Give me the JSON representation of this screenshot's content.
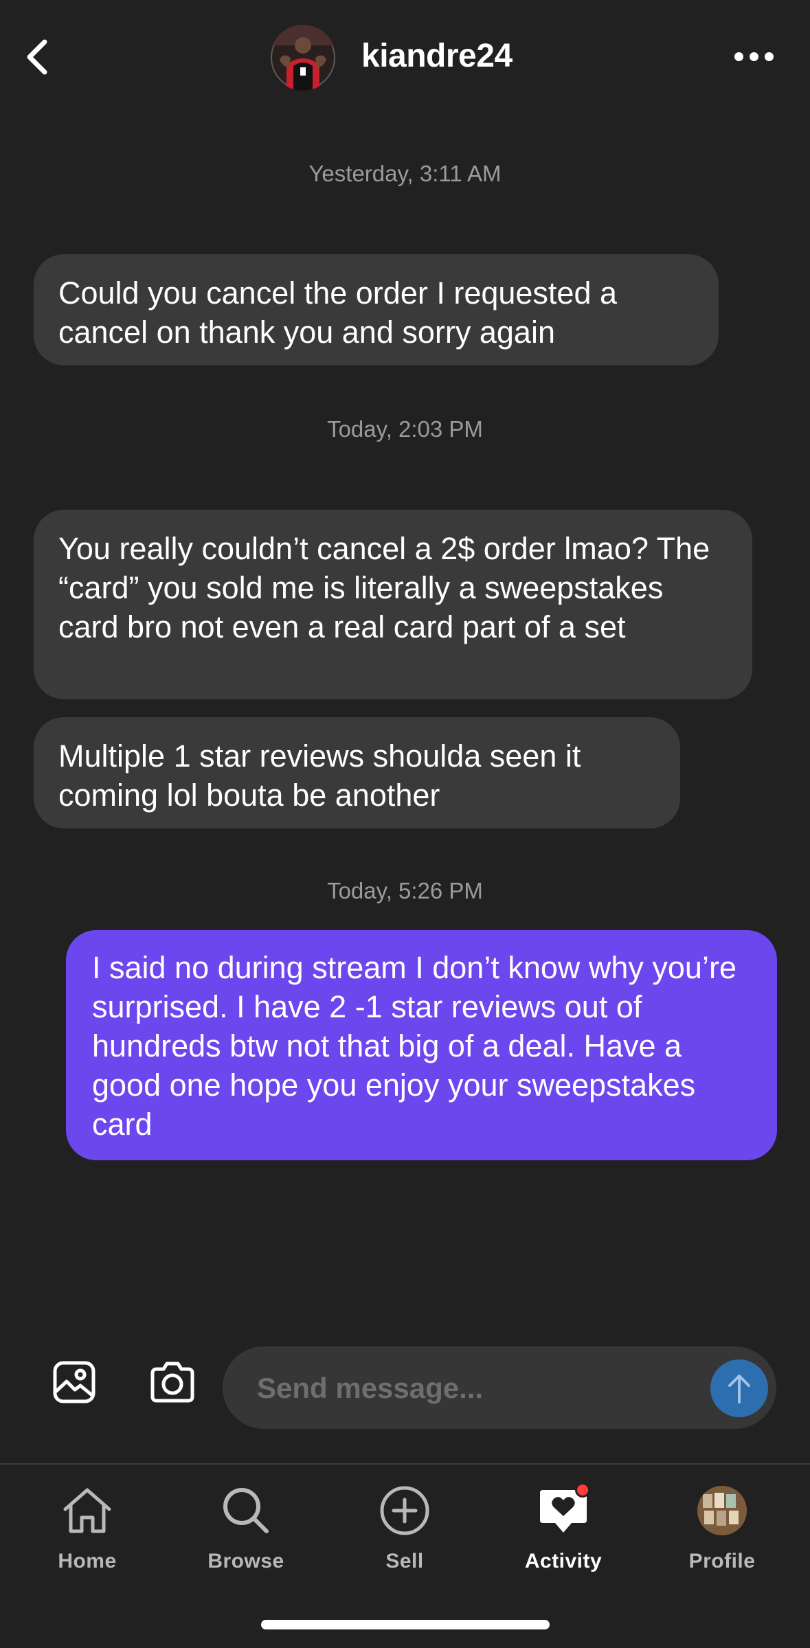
{
  "header": {
    "title": "kiandre24"
  },
  "messages": [
    {
      "type": "timestamp",
      "text": "Yesterday, 3:11 AM"
    },
    {
      "type": "incoming",
      "text": "Could you cancel the order I requested a cancel on thank you and sorry again"
    },
    {
      "type": "timestamp",
      "text": "Today, 2:03 PM"
    },
    {
      "type": "incoming",
      "text": "You really couldn’t cancel a 2$ order lmao? The “card” you sold me is literally a sweepstakes card bro not even a real card part of a set"
    },
    {
      "type": "incoming",
      "text": "Multiple 1 star reviews shoulda seen it coming lol bouta be another"
    },
    {
      "type": "timestamp",
      "text": "Today, 5:26 PM"
    },
    {
      "type": "outgoing",
      "text": "I said no during stream I don’t know why you’re surprised. I have 2 -1 star reviews out of hundreds btw not that big of a deal. Have a good one hope you enjoy your sweepstakes card"
    }
  ],
  "composer": {
    "placeholder": "Send message..."
  },
  "tabbar": {
    "items": [
      {
        "label": "Home",
        "icon": "home-icon"
      },
      {
        "label": "Browse",
        "icon": "search-icon"
      },
      {
        "label": "Sell",
        "icon": "plus-circle-icon"
      },
      {
        "label": "Activity",
        "icon": "chat-heart-icon",
        "active": true,
        "badge": true
      },
      {
        "label": "Profile",
        "icon": "profile-avatar"
      }
    ]
  },
  "colors": {
    "background": "#212121",
    "incoming_bubble": "#3a3a3a",
    "outgoing_bubble": "#6c47ee",
    "send_button": "#2d6fae",
    "timestamp": "#9b9b9b",
    "badge": "#ff3b3b"
  }
}
